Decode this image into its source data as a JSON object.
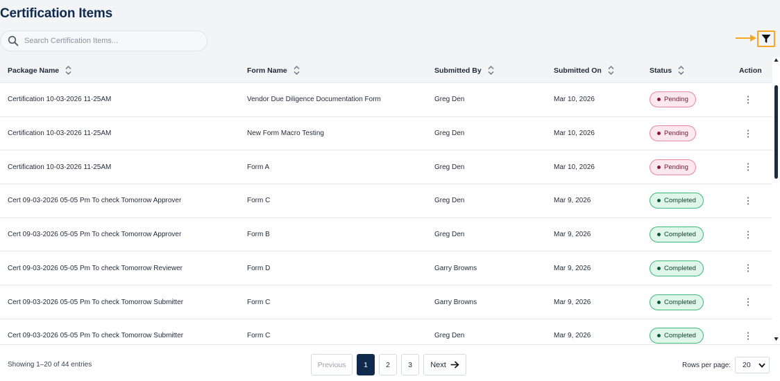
{
  "page": {
    "title": "Certification Items"
  },
  "search": {
    "placeholder": "Search Certification Items..."
  },
  "colors": {
    "brand": "#0f2a4d",
    "highlight": "#f5a623",
    "pending": "#8b1538",
    "completed": "#0e5a3a"
  },
  "icons": {
    "search": "search-icon",
    "filter": "filter-icon",
    "sort": "sort-icon",
    "kebab": "kebab-menu-icon",
    "next": "arrow-right-icon"
  },
  "table": {
    "columns": [
      "Package Name",
      "Form Name",
      "Submitted By",
      "Submitted On",
      "Status",
      "Action"
    ],
    "rows": [
      {
        "package": "Certification 10-03-2026 11-25AM",
        "form": "Vendor Due Diligence Documentation Form",
        "submitted_by": "Greg Den",
        "submitted_on": "Mar 10, 2026",
        "status": "Pending"
      },
      {
        "package": "Certification 10-03-2026 11-25AM",
        "form": "New Form Macro Testing",
        "submitted_by": "Greg Den",
        "submitted_on": "Mar 10, 2026",
        "status": "Pending"
      },
      {
        "package": "Certification 10-03-2026 11-25AM",
        "form": "Form A",
        "submitted_by": "Greg Den",
        "submitted_on": "Mar 10, 2026",
        "status": "Pending"
      },
      {
        "package": "Cert 09-03-2026 05-05 Pm To check Tomorrow Approver",
        "form": "Form C",
        "submitted_by": "Greg Den",
        "submitted_on": "Mar 9, 2026",
        "status": "Completed"
      },
      {
        "package": "Cert 09-03-2026 05-05 Pm To check Tomorrow Approver",
        "form": "Form B",
        "submitted_by": "Greg Den",
        "submitted_on": "Mar 9, 2026",
        "status": "Completed"
      },
      {
        "package": "Cert 09-03-2026 05-05 Pm To check Tomorrow Reviewer",
        "form": "Form D",
        "submitted_by": "Garry Browns",
        "submitted_on": "Mar 9, 2026",
        "status": "Completed"
      },
      {
        "package": "Cert 09-03-2026 05-05 Pm To check Tomorrow Submitter",
        "form": "Form C",
        "submitted_by": "Garry Browns",
        "submitted_on": "Mar 9, 2026",
        "status": "Completed"
      },
      {
        "package": "Cert 09-03-2026 05-05 Pm To check Tomorrow Submitter",
        "form": "Form C",
        "submitted_by": "Greg Den",
        "submitted_on": "Mar 9, 2026",
        "status": "Completed"
      }
    ]
  },
  "footer": {
    "showing": "Showing 1–20 of 44 entries",
    "previous": "Previous",
    "pages": [
      "1",
      "2",
      "3"
    ],
    "current_page": "1",
    "next": "Next",
    "rows_per_page_label": "Rows per page:",
    "rows_per_page_value": "20"
  }
}
